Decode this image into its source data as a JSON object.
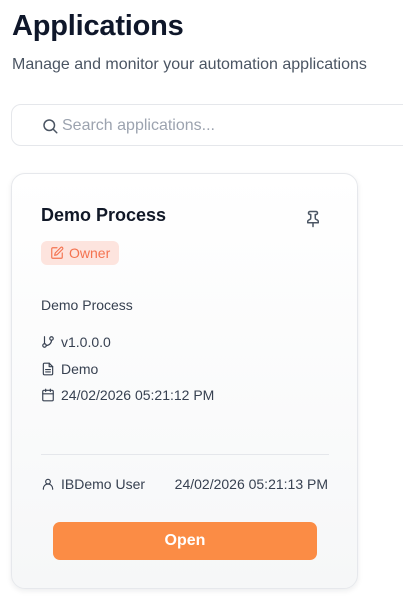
{
  "header": {
    "title": "Applications",
    "subtitle": "Manage and monitor your automation applications"
  },
  "search": {
    "placeholder": "Search applications...",
    "value": "",
    "icon": "search-icon"
  },
  "applications": [
    {
      "name": "Demo Process",
      "role": "Owner",
      "role_icon": "edit-icon",
      "pin_icon": "pin-icon",
      "description": "Demo Process",
      "version": "v1.0.0.0",
      "version_icon": "git-branch-icon",
      "category": "Demo",
      "category_icon": "file-icon",
      "created": "24/02/2026 05:21:12 PM",
      "created_icon": "calendar-icon",
      "owner_user": "IBDemo User",
      "owner_icon": "user-icon",
      "updated": "24/02/2026 05:21:13 PM",
      "action_label": "Open"
    }
  ],
  "colors": {
    "accent": "#fb8c45",
    "badge_bg": "#fde4de",
    "badge_text": "#f47350",
    "title_text": "#0f172a"
  }
}
